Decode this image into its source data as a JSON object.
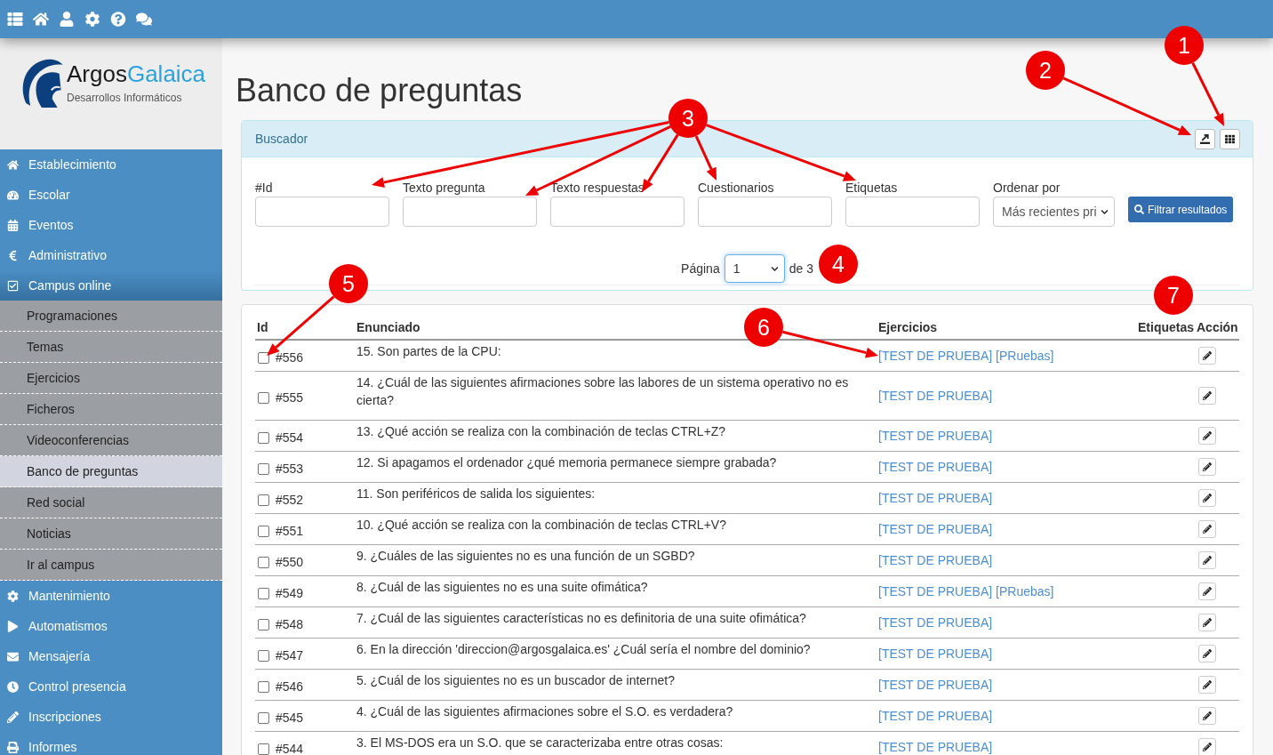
{
  "sidebar": {
    "logo": {
      "name_first": "Argos",
      "name_second": "Galaica",
      "tagline": "Desarrollos Informáticos"
    },
    "items": [
      {
        "label": "Establecimiento",
        "expanded": false
      },
      {
        "label": "Escolar",
        "expanded": false
      },
      {
        "label": "Eventos",
        "expanded": false
      },
      {
        "label": "Administrativo",
        "expanded": false
      },
      {
        "label": "Campus online",
        "expanded": true,
        "children": [
          {
            "label": "Programaciones",
            "selected": false
          },
          {
            "label": "Temas",
            "selected": false
          },
          {
            "label": "Ejercicios",
            "selected": false
          },
          {
            "label": "Ficheros",
            "selected": false
          },
          {
            "label": "Videoconferencias",
            "selected": false
          },
          {
            "label": "Banco de preguntas",
            "selected": true
          },
          {
            "label": "Red social",
            "selected": false
          },
          {
            "label": "Noticias",
            "selected": false
          },
          {
            "label": "Ir al campus",
            "selected": false
          }
        ]
      },
      {
        "label": "Mantenimiento",
        "expanded": false
      },
      {
        "label": "Automatismos",
        "expanded": false
      },
      {
        "label": "Mensajería",
        "expanded": false
      },
      {
        "label": "Control presencia",
        "expanded": false
      },
      {
        "label": "Inscripciones",
        "expanded": false
      },
      {
        "label": "Informes",
        "expanded": false
      }
    ]
  },
  "page": {
    "title": "Banco de preguntas"
  },
  "search_panel": {
    "title": "Buscador",
    "filters": [
      {
        "label": "#Id"
      },
      {
        "label": "Texto pregunta"
      },
      {
        "label": "Texto respuestas"
      },
      {
        "label": "Cuestionarios"
      },
      {
        "label": "Etiquetas"
      }
    ],
    "sort": {
      "label": "Ordenar por",
      "value": "Más recientes pri"
    },
    "submit_button": "Filtrar resultados",
    "pagination": {
      "label": "Página",
      "value": "1",
      "focused": true,
      "total": "de 3"
    }
  },
  "table": {
    "columns": [
      "Id",
      "Enunciado",
      "Ejercicios",
      "Etiquetas",
      "Acción"
    ],
    "rows": [
      {
        "checked": false,
        "id": "#556",
        "question": "15. Son partes de la CPU:",
        "exercises": [
          "[TEST DE PRUEBA]",
          "[PRuebas]"
        ]
      },
      {
        "checked": false,
        "id": "#555",
        "question": "14. ¿Cuál de las siguientes afirmaciones sobre las labores de un sistema operativo no es cierta?",
        "exercises": [
          "[TEST DE PRUEBA]"
        ]
      },
      {
        "checked": false,
        "id": "#554",
        "question": "13. ¿Qué acción se realiza con la combinación de teclas CTRL+Z?",
        "exercises": [
          "[TEST DE PRUEBA]"
        ]
      },
      {
        "checked": false,
        "id": "#553",
        "question": "12. Si apagamos el ordenador ¿qué memoria permanece siempre grabada?",
        "exercises": [
          "[TEST DE PRUEBA]"
        ]
      },
      {
        "checked": false,
        "id": "#552",
        "question": "11. Son periféricos de salida los siguientes:",
        "exercises": [
          "[TEST DE PRUEBA]"
        ]
      },
      {
        "checked": false,
        "id": "#551",
        "question": "10. ¿Qué acción se realiza con la combinación de teclas CTRL+V?",
        "exercises": [
          "[TEST DE PRUEBA]"
        ]
      },
      {
        "checked": false,
        "id": "#550",
        "question": "9. ¿Cuáles de las siguientes no es una función de un SGBD?",
        "exercises": [
          "[TEST DE PRUEBA]"
        ]
      },
      {
        "checked": false,
        "id": "#549",
        "question": "8. ¿Cuál de las siguientes no es una suite ofimática?",
        "exercises": [
          "[TEST DE PRUEBA]",
          "[PRuebas]"
        ]
      },
      {
        "checked": false,
        "id": "#548",
        "question": "7. ¿Cuál de las siguientes características no es definitoria de una suite ofimática?",
        "exercises": [
          "[TEST DE PRUEBA]"
        ]
      },
      {
        "checked": false,
        "id": "#547",
        "question": "6. En la dirección 'direccion@argosgalaica.es' ¿Cuál sería el nombre del dominio?",
        "exercises": [
          "[TEST DE PRUEBA]"
        ]
      },
      {
        "checked": false,
        "id": "#546",
        "question": "5. ¿Cuál de los siguientes no es un buscador de internet?",
        "exercises": [
          "[TEST DE PRUEBA]"
        ]
      },
      {
        "checked": false,
        "id": "#545",
        "question": "4. ¿Cuál de las siguientes afirmaciones sobre el S.O. es verdadera?",
        "exercises": [
          "[TEST DE PRUEBA]"
        ]
      },
      {
        "checked": false,
        "id": "#544",
        "question": "3. El MS-DOS era un S.O. que se caracterizaba entre otras cosas:",
        "exercises": [
          "[TEST DE PRUEBA]"
        ]
      }
    ]
  },
  "annotations": [
    {
      "label": "1"
    },
    {
      "label": "2"
    },
    {
      "label": "3"
    },
    {
      "label": "4"
    },
    {
      "label": "5"
    },
    {
      "label": "6"
    },
    {
      "label": "7"
    }
  ]
}
